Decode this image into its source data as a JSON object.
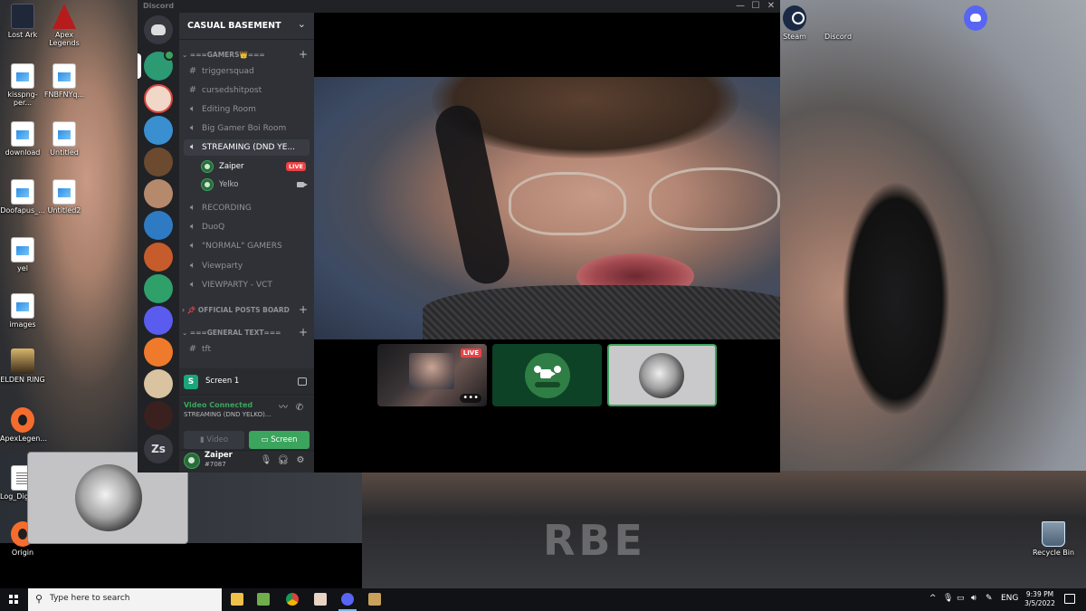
{
  "desktop": {
    "left_icons": [
      {
        "label": "Lost Ark",
        "glyph": "app-dark"
      },
      {
        "label": "Apex Legends",
        "glyph": "apex"
      },
      {
        "label": "kisspng-per...",
        "glyph": "doc"
      },
      {
        "label": "FNBFNYq...",
        "glyph": "doc"
      },
      {
        "label": "download",
        "glyph": "doc"
      },
      {
        "label": "Untitled",
        "glyph": "doc"
      },
      {
        "label": "Doofapus_...",
        "glyph": "doc"
      },
      {
        "label": "Untitled2",
        "glyph": "doc"
      },
      {
        "label": "yel",
        "glyph": "doc"
      },
      {
        "label": "images",
        "glyph": "doc"
      },
      {
        "label": "ELDEN RING",
        "glyph": "elden"
      },
      {
        "label": "ApexLegen...",
        "glyph": "origin"
      },
      {
        "label": "Log_Digital...",
        "glyph": "text"
      },
      {
        "label": "Origin",
        "glyph": "origin"
      }
    ],
    "right_icons": [
      {
        "label": "Steam",
        "glyph": "steam"
      },
      {
        "label": "Discord",
        "glyph": "discord"
      },
      {
        "label": "Recycle Bin",
        "glyph": "bin"
      }
    ],
    "wallpaper_text": "RBE"
  },
  "discord": {
    "window_title": "Discord",
    "window_buttons": {
      "minimize": "—",
      "maximize": "☐",
      "close": "✕"
    },
    "server_zs_label": "Zs",
    "guild_name": "CASUAL BASEMENT",
    "categories": {
      "gamers": "===GAMERS👑===",
      "official": "OFFICIAL POSTS BOARD",
      "general": "===GENERAL TEXT==="
    },
    "channels_top": [
      {
        "name": "triggersquad",
        "type": "text"
      },
      {
        "name": "cursedshitpost",
        "type": "text"
      },
      {
        "name": "Editing Room",
        "type": "voice"
      },
      {
        "name": "Big Gamer Boi Room",
        "type": "voice"
      },
      {
        "name": "STREAMING (DND YE...",
        "type": "voice"
      }
    ],
    "voice_users": [
      {
        "name": "Zaiper",
        "badge": "LIVE"
      },
      {
        "name": "Yelko",
        "badge": ""
      }
    ],
    "channels_after": [
      {
        "name": "RECORDING",
        "type": "voice"
      },
      {
        "name": "DuoQ",
        "type": "voice"
      },
      {
        "name": "\"NORMAL\" GAMERS",
        "type": "voice"
      },
      {
        "name": "Viewparty",
        "type": "voice"
      },
      {
        "name": "VIEWPARTY - VCT",
        "type": "voice"
      }
    ],
    "general_channels": [
      {
        "name": "tft",
        "type": "text"
      }
    ],
    "screen_panel": {
      "icon_letter": "S",
      "label": "Screen 1"
    },
    "voice_panel": {
      "status": "Video Connected",
      "channel": "STREAMING (DND YELKO)...",
      "video_button": "Video",
      "screen_button": "Screen"
    },
    "user": {
      "name": "Zaiper",
      "tag": "#7087"
    },
    "thumbnail_live": "LIVE",
    "thumbnail_more": "•••",
    "accent_green": "#3ba55d",
    "live_red": "#ed4245"
  },
  "taskbar": {
    "search_placeholder": "Type here to search",
    "tray": {
      "language": "ENG"
    },
    "time": "9:39 PM",
    "date": "3/5/2022"
  }
}
